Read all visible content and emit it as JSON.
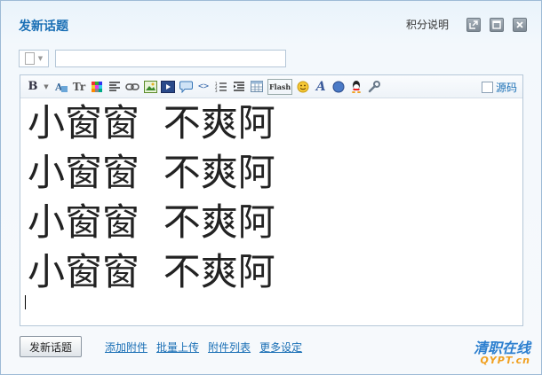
{
  "header": {
    "title": "发新话题",
    "help_link": "积分说明",
    "buttons": [
      {
        "name": "popout",
        "icon": "popout-icon"
      },
      {
        "name": "maximize",
        "icon": "maximize-icon"
      },
      {
        "name": "close",
        "icon": "close-icon"
      }
    ]
  },
  "subject": {
    "type_icon": "document-icon",
    "value": "",
    "placeholder": ""
  },
  "toolbar": {
    "items": [
      {
        "icon": "bold-icon",
        "glyph": "B"
      },
      {
        "icon": "font-color-icon"
      },
      {
        "icon": "font-size-icon",
        "glyph": "Tr"
      },
      {
        "icon": "color-palette-icon"
      },
      {
        "icon": "align-left-icon"
      },
      {
        "icon": "link-icon"
      },
      {
        "icon": "image-icon"
      },
      {
        "icon": "media-icon"
      },
      {
        "icon": "quote-icon"
      },
      {
        "icon": "code-icon",
        "glyph": "<>"
      },
      {
        "icon": "ordered-list-icon"
      },
      {
        "icon": "indent-icon"
      },
      {
        "icon": "table-icon"
      },
      {
        "icon": "flash-icon",
        "glyph": "Flash"
      },
      {
        "icon": "smiley-icon"
      },
      {
        "icon": "font-style-icon",
        "glyph": "A"
      },
      {
        "icon": "compass-icon"
      },
      {
        "icon": "qq-icon"
      },
      {
        "icon": "wrench-icon"
      }
    ],
    "source_label": "源码",
    "source_checked": false
  },
  "content": {
    "lines": [
      "小窗窗  不爽阿",
      "小窗窗  不爽阿",
      "小窗窗  不爽阿",
      "小窗窗  不爽阿"
    ]
  },
  "footer": {
    "submit_label": "发新话题",
    "links": [
      "添加附件",
      "批量上传",
      "附件列表",
      "更多设定"
    ]
  },
  "watermark": {
    "top": "清职在线",
    "bottom": "QYPT.cn"
  },
  "colors": {
    "accent": "#1a6fb5",
    "border": "#b5c7d8"
  }
}
